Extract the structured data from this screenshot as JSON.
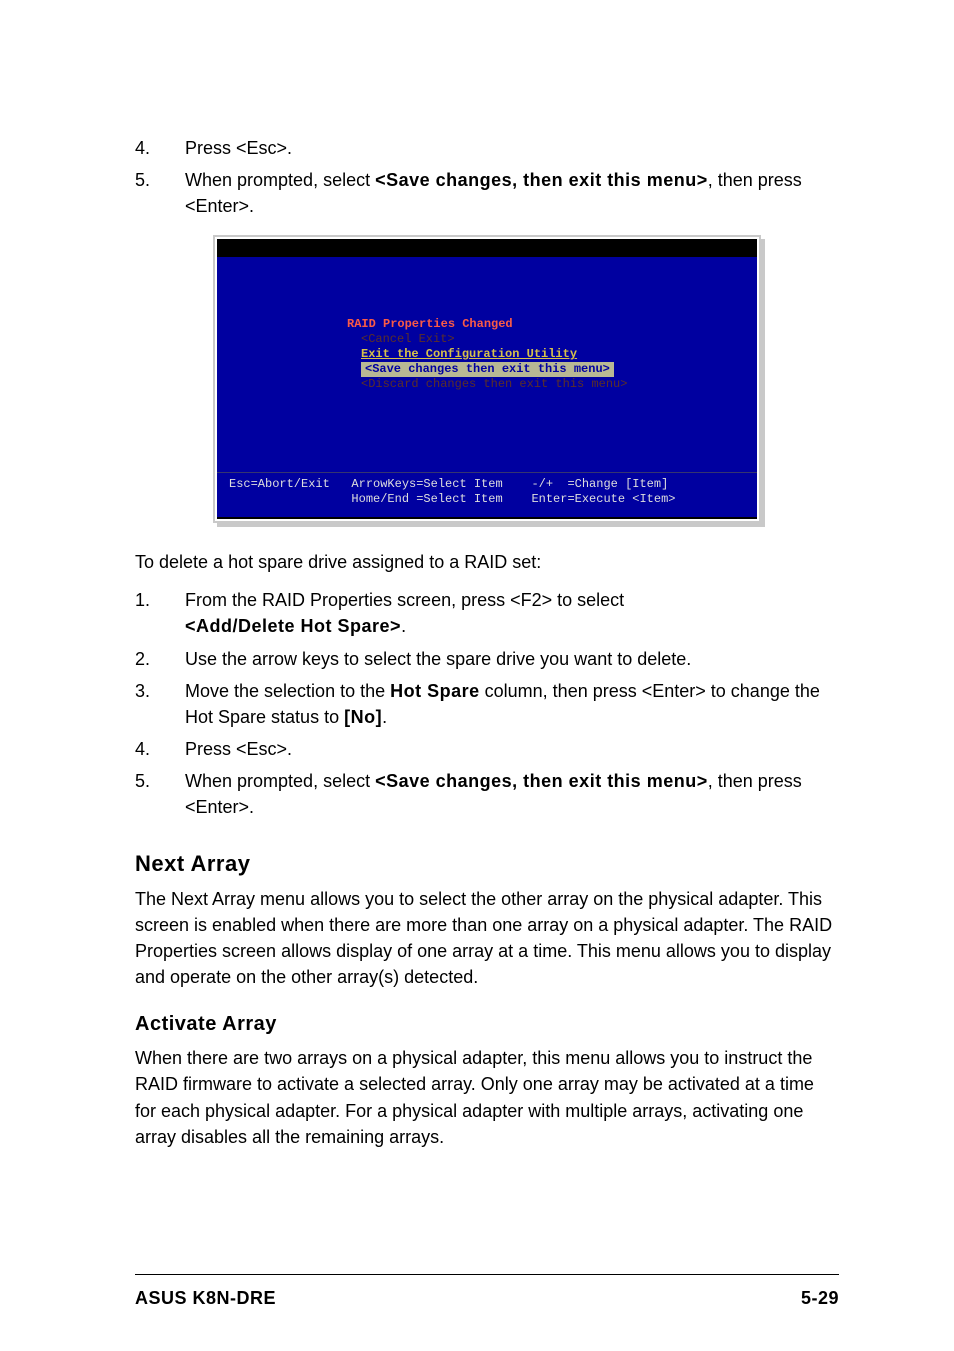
{
  "list1": {
    "item4": "Press <Esc>.",
    "item5_a": "When prompted, select ",
    "item5_bold": "<Save changes, then exit this menu>",
    "item5_b": ", then press <Enter>."
  },
  "screenshot": {
    "title": "RAID Properties Changed",
    "opt_cancel": "<Cancel Exit>",
    "opt_exit": "Exit the Configuration Utility",
    "opt_save": "<Save changes then exit this menu>",
    "opt_discard": "<Discard changes then exit this menu>",
    "footer": "Esc=Abort/Exit   ArrowKeys=Select Item    -/+  =Change [Item]\n                 Home/End =Select Item    Enter=Execute <Item>"
  },
  "delete_intro": "To delete a hot spare drive assigned to a RAID set:",
  "list2": {
    "item1_a": "From the RAID Properties screen, press <F2> to select ",
    "item1_bold": "<Add/Delete Hot Spare>",
    "item1_b": ".",
    "item2": "Use the arrow keys to select the spare drive you want to delete.",
    "item3_a": "Move the selection to the ",
    "item3_bold1": "Hot Spare",
    "item3_b": " column, then press <Enter> to change the Hot Spare status to ",
    "item3_bold2": "[No]",
    "item3_c": ".",
    "item4": "Press <Esc>.",
    "item5_a": "When prompted, select ",
    "item5_bold": "<Save changes, then exit this menu>",
    "item5_b": ", then press <Enter>."
  },
  "next_array": {
    "heading": "Next Array",
    "body": "The Next Array menu allows you to select the other array on the physical adapter. This screen is enabled when there are more than one array on a physical adapter. The RAID Properties screen allows display of one array at a time. This menu allows you to display and operate on the other array(s) detected."
  },
  "activate_array": {
    "heading": "Activate Array",
    "body": "When there are two arrays on a physical adapter, this menu allows you to instruct the RAID firmware to activate a selected array. Only one array may be activated at a time for each physical adapter. For a physical adapter with multiple arrays, activating one array disables all the remaining arrays."
  },
  "footer": {
    "left": "ASUS K8N-DRE",
    "right": "5-29"
  }
}
